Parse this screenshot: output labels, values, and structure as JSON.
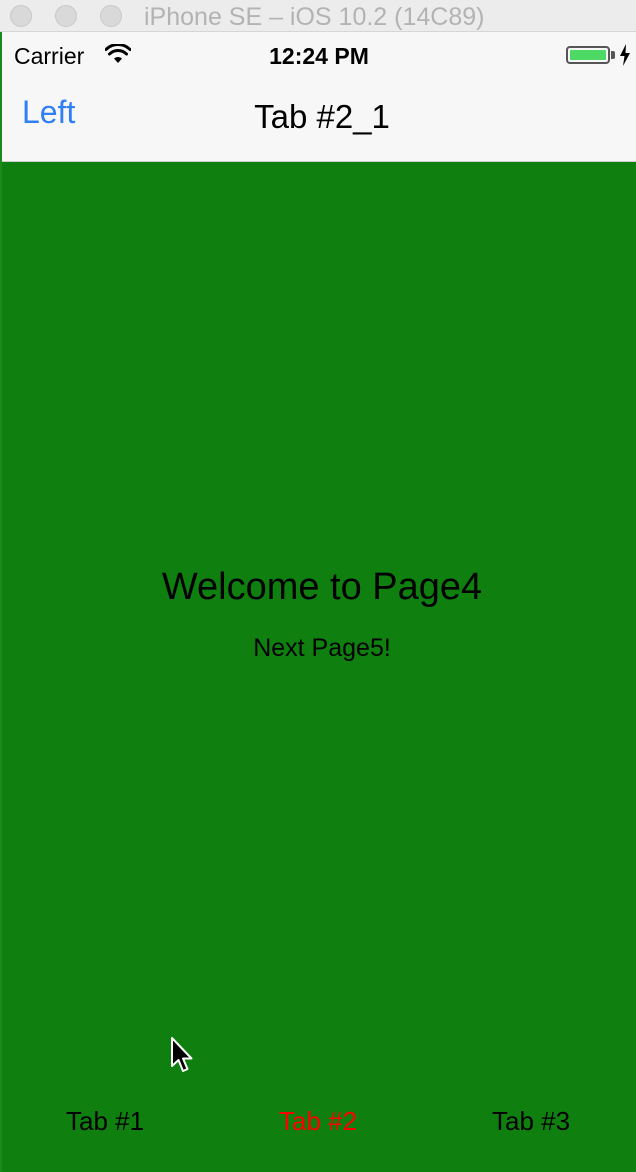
{
  "window": {
    "title": "iPhone SE – iOS 10.2 (14C89)"
  },
  "status_bar": {
    "carrier": "Carrier",
    "wifi_icon": "wifi-icon",
    "time": "12:24 PM",
    "battery_icon": "battery-icon",
    "battery_level": 1.0,
    "charging_icon": "lightning-bolt-icon"
  },
  "nav_bar": {
    "left_button": "Left",
    "title": "Tab #2_1"
  },
  "content": {
    "heading": "Welcome to Page4",
    "link": "Next Page5!"
  },
  "tab_bar": {
    "tabs": [
      {
        "label": "Tab #1",
        "active": false
      },
      {
        "label": "Tab #2",
        "active": true
      },
      {
        "label": "Tab #3",
        "active": false
      }
    ]
  },
  "colors": {
    "content_background": "#0f800f",
    "nav_button": "#2f7ff5",
    "active_tab": "#ff0000",
    "inactive_tab": "#000000",
    "battery_fill": "#4cd964"
  }
}
